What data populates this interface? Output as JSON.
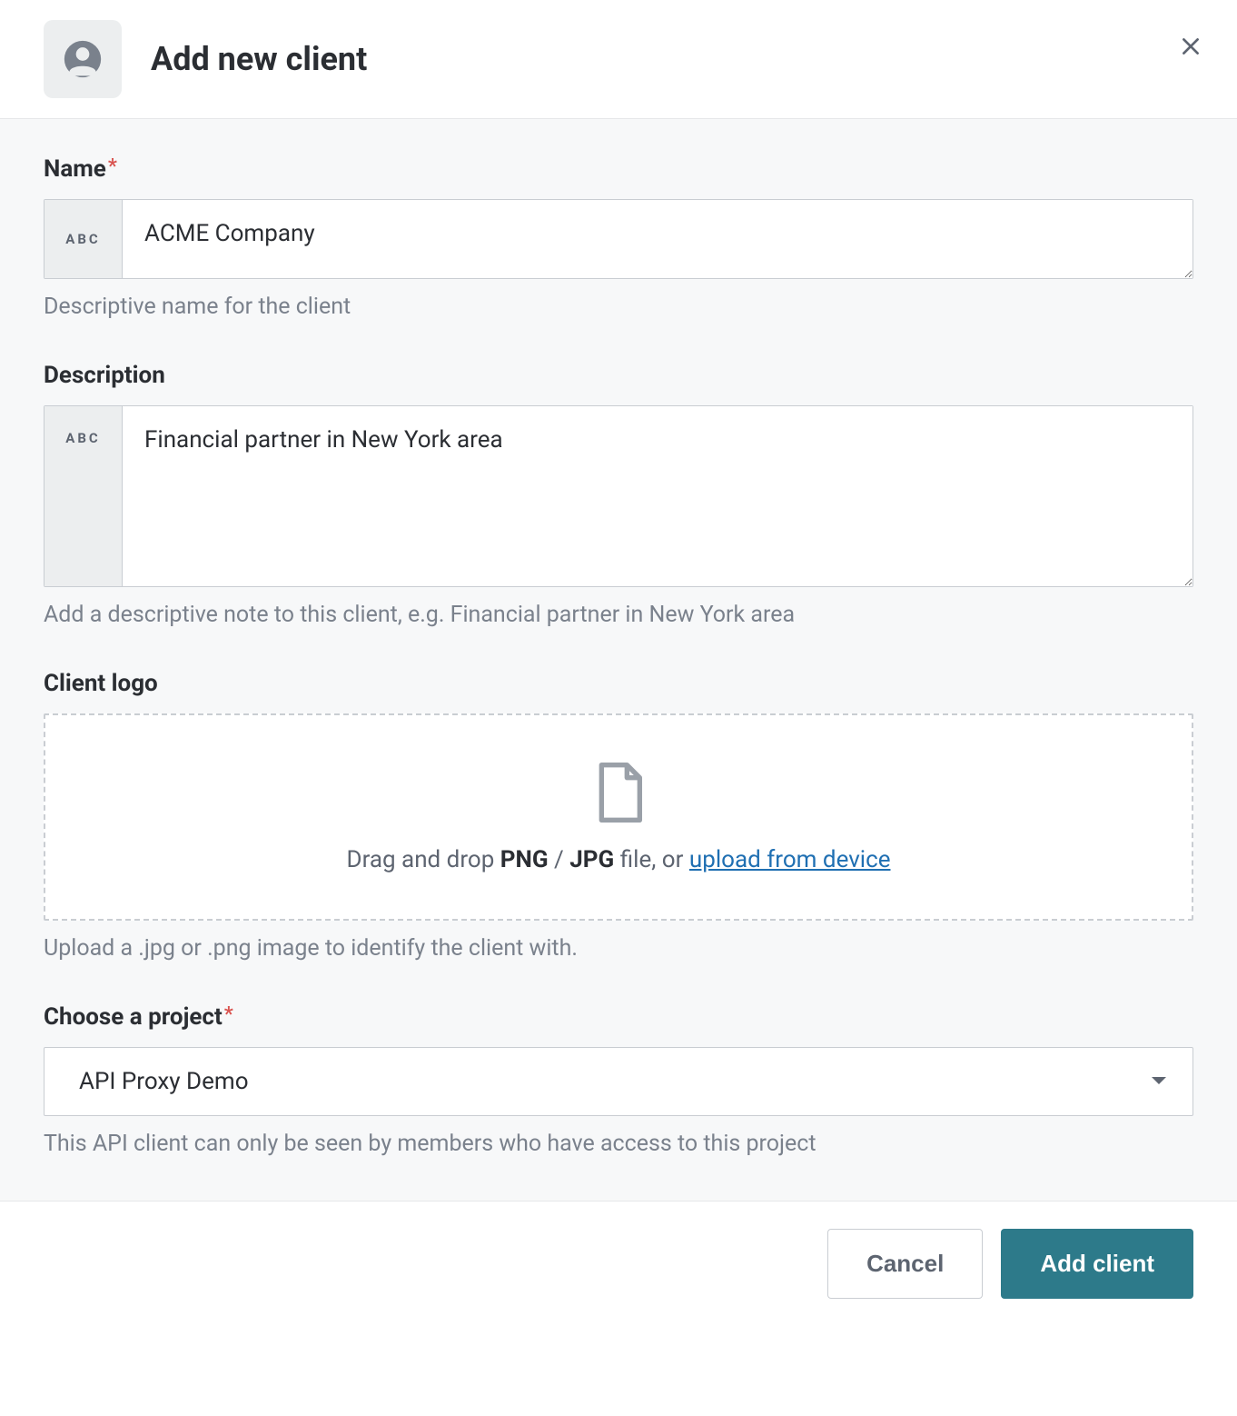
{
  "header": {
    "title": "Add new client"
  },
  "fields": {
    "name": {
      "label": "Name",
      "value": "ACME Company",
      "help": "Descriptive name for the client",
      "prefix": "ABC"
    },
    "description": {
      "label": "Description",
      "value": "Financial partner in New York area",
      "help": "Add a descriptive note to this client, e.g. Financial partner in New York area",
      "prefix": "ABC"
    },
    "logo": {
      "label": "Client logo",
      "drop_prefix": "Drag and drop ",
      "png": "PNG",
      "slash": " / ",
      "jpg": "JPG",
      "file_or": " file, or ",
      "upload_link": "upload from device",
      "help": "Upload a .jpg or .png image to identify the client with."
    },
    "project": {
      "label": "Choose a project",
      "selected": "API Proxy Demo",
      "help": "This API client can only be seen by members who have access to this project"
    }
  },
  "footer": {
    "cancel": "Cancel",
    "submit": "Add client"
  }
}
